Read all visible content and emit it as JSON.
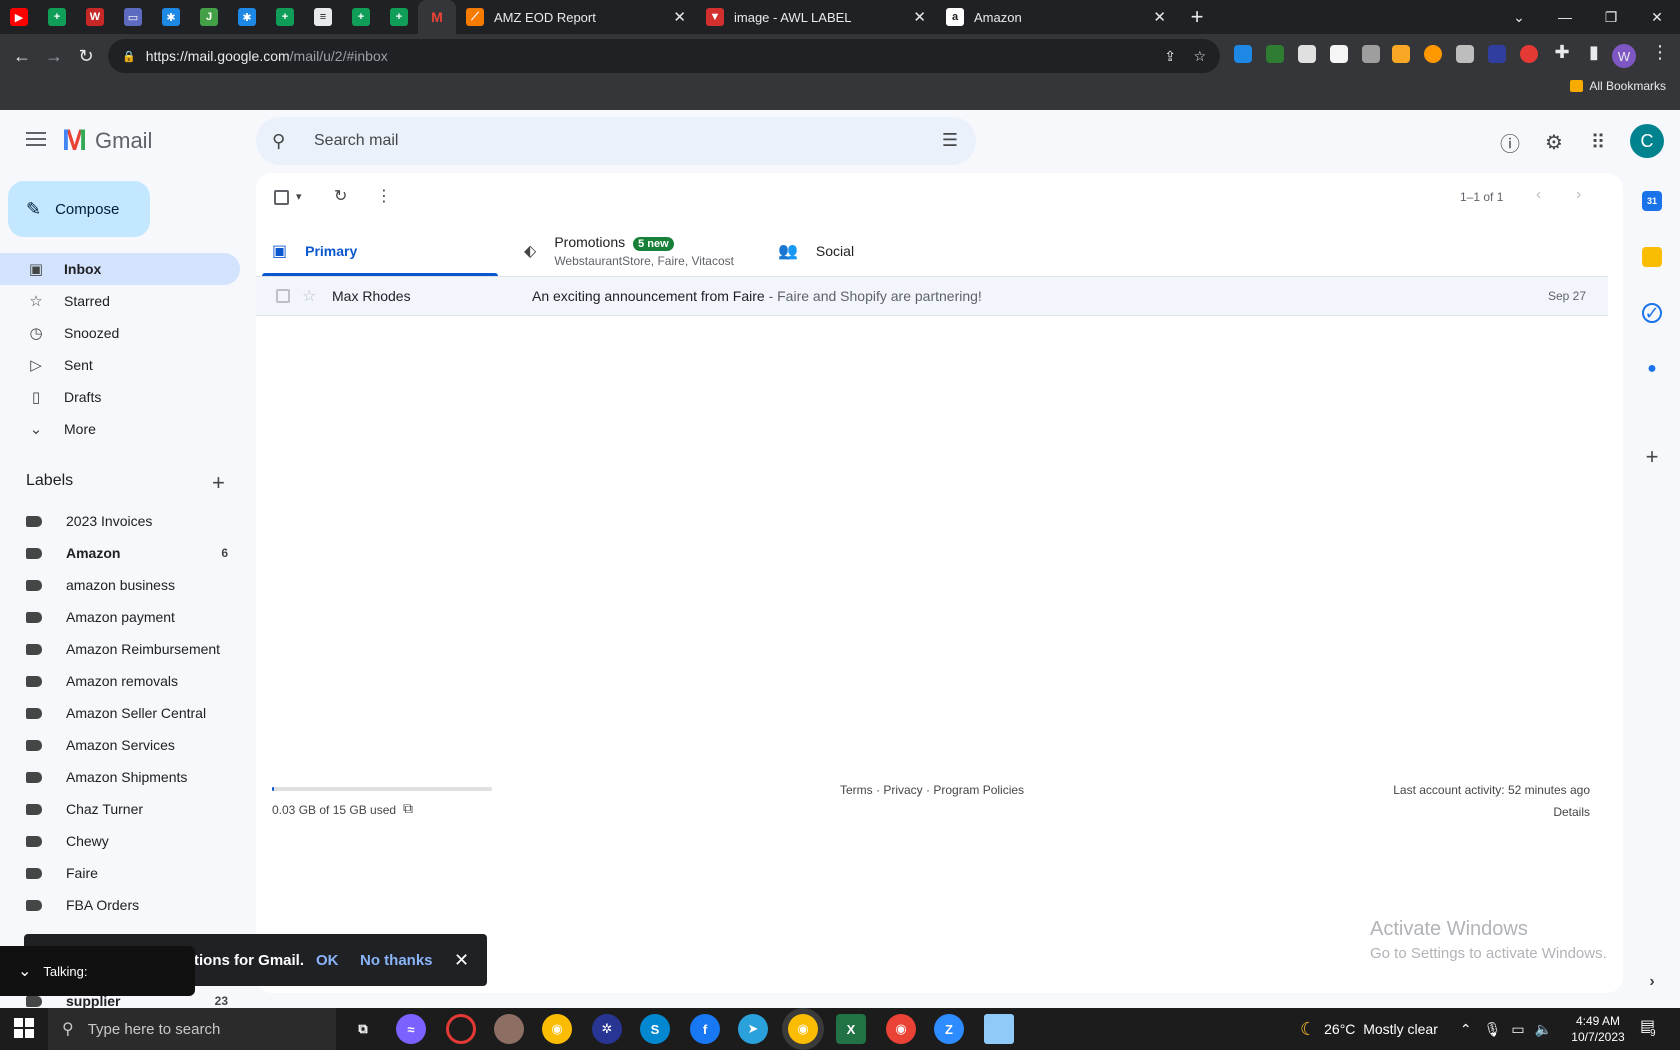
{
  "browser": {
    "tabs": [
      {
        "title": "AMZ EOD Report",
        "favicon_color": "#f57c00"
      },
      {
        "title": "image - AWL LABEL",
        "favicon_color": "#d32f2f"
      },
      {
        "title": "Amazon",
        "favicon_color": "#ffffff"
      }
    ],
    "new_tab": "+",
    "url_host": "https://mail.google.com",
    "url_path": "/mail/u/2/#inbox",
    "bookmarks_folder": "All Bookmarks",
    "profile_initial": "W"
  },
  "gmail": {
    "logo_text": "Gmail",
    "search_placeholder": "Search mail",
    "avatar_initial": "C",
    "compose_label": "Compose",
    "nav": [
      {
        "label": "Inbox",
        "icon": "inbox-icon",
        "selected": true
      },
      {
        "label": "Starred",
        "icon": "star-icon"
      },
      {
        "label": "Snoozed",
        "icon": "clock-icon"
      },
      {
        "label": "Sent",
        "icon": "send-icon"
      },
      {
        "label": "Drafts",
        "icon": "draft-icon"
      },
      {
        "label": "More",
        "icon": "chevron-down-icon"
      }
    ],
    "labels_title": "Labels",
    "labels": [
      {
        "name": "2023 Invoices",
        "count": ""
      },
      {
        "name": "Amazon",
        "count": "6",
        "bold": true
      },
      {
        "name": "amazon business",
        "count": ""
      },
      {
        "name": "Amazon payment",
        "count": ""
      },
      {
        "name": "Amazon Reimbursement",
        "count": ""
      },
      {
        "name": "Amazon removals",
        "count": ""
      },
      {
        "name": "Amazon Seller Central",
        "count": ""
      },
      {
        "name": "Amazon Services",
        "count": ""
      },
      {
        "name": "Amazon Shipments",
        "count": ""
      },
      {
        "name": "Chaz Turner",
        "count": ""
      },
      {
        "name": "Chewy",
        "count": ""
      },
      {
        "name": "Faire",
        "count": ""
      },
      {
        "name": "FBA Orders",
        "count": ""
      },
      {
        "name": "supplier",
        "count": "23",
        "bold": true
      }
    ],
    "pager": "1–1 of 1",
    "categories": {
      "primary": "Primary",
      "promotions": "Promotions",
      "promotions_badge": "5 new",
      "promotions_senders": "WebstaurantStore, Faire, Vitacost",
      "social": "Social"
    },
    "emails": [
      {
        "sender": "Max Rhodes",
        "subject": "An exciting announcement from Faire",
        "snippet": " - Faire and Shopify are partnering!",
        "date": "Sep 27"
      }
    ],
    "storage": {
      "text": "0.03 GB of 15 GB used",
      "fraction": 0.002
    },
    "footer": {
      "terms": "Terms",
      "privacy": "Privacy",
      "policies": "Program Policies",
      "sep": " · "
    },
    "activity": "Last account activity: 52 minutes ago",
    "details": "Details",
    "toast": {
      "message": "tions for Gmail.",
      "ok": "OK",
      "no": "No thanks"
    },
    "talking": "Talking:"
  },
  "watermark": {
    "line1": "Activate Windows",
    "line2": "Go to Settings to activate Windows."
  },
  "taskbar": {
    "search_placeholder": "Type here to search",
    "weather": "26°C  Mostly clear",
    "time": "4:49 AM",
    "date": "10/7/2023",
    "notifications": "9"
  }
}
